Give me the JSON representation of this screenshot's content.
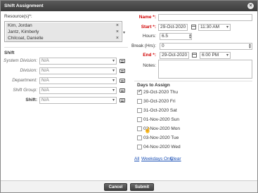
{
  "dialog": {
    "title": "Shift Assignment"
  },
  "resources": {
    "label": "Resource(s)*:",
    "items": [
      "Kim, Jordan",
      "Jantz, Kimberly",
      "Chilcoat, Danielle"
    ],
    "remove_glyph": "×"
  },
  "shift": {
    "section_title": "Shift",
    "fields": [
      {
        "label": "System Division:",
        "value": "N/A",
        "bold": false
      },
      {
        "label": "Division:",
        "value": "N/A",
        "bold": false
      },
      {
        "label": "Department:",
        "value": "N/A",
        "bold": false
      },
      {
        "label": "Shift Group:",
        "value": "N/A",
        "bold": false
      },
      {
        "label": "Shift:",
        "value": "N/A",
        "bold": true
      }
    ]
  },
  "form": {
    "name_label": "Name *:",
    "name_value": "",
    "start_label": "Start *:",
    "start_date": "29-Oct-2020",
    "start_time": "11:30 AM",
    "hours_label": "Hours:",
    "hours_value": "6.5",
    "break_label": "Break (Hrs):",
    "break_value": "0",
    "end_label": "End *:",
    "end_date": "29-Oct-2020",
    "end_time": "6:00 PM",
    "notes_label": "Notes:",
    "notes_value": ""
  },
  "days": {
    "title": "Days to Assign",
    "items": [
      {
        "label": "29-Oct-2020 Thu",
        "checked": true
      },
      {
        "label": "30-Oct-2020 Fri",
        "checked": false
      },
      {
        "label": "31-Oct-2020 Sat",
        "checked": false
      },
      {
        "label": "01-Nov-2020 Sun",
        "checked": false
      },
      {
        "label": "02-Nov-2020 Mon",
        "checked": false
      },
      {
        "label": "03-Nov-2020 Tue",
        "checked": false
      },
      {
        "label": "04-Nov-2020 Wed",
        "checked": false
      }
    ],
    "links": {
      "all": "All",
      "weekdays": "Weekdays Only",
      "clear": "Clear"
    }
  },
  "buttons": {
    "cancel": "Cancel",
    "submit": "Submit"
  },
  "colors": {
    "required": "#d10000",
    "link": "#1a4fb5",
    "titlebar": "#4a4a4a"
  }
}
